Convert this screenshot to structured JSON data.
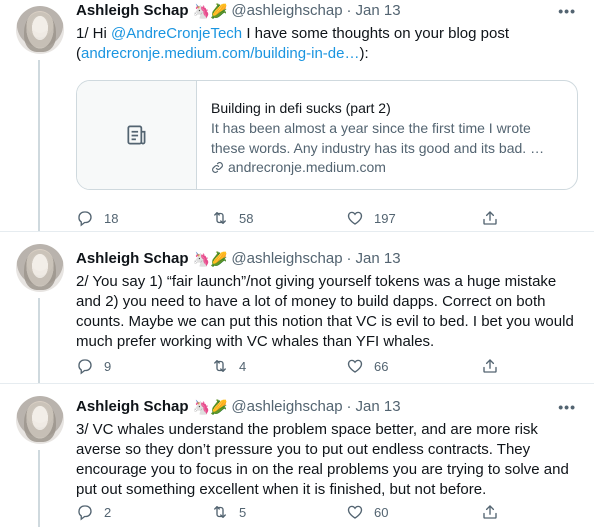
{
  "tweets": [
    {
      "name": "Ashleigh Schap",
      "emoji": "🦄🌽",
      "handle": "@ashleighschap",
      "dot": "·",
      "date": "Jan 13",
      "text_prefix": "1/ Hi ",
      "mention": "@AndreCronjeTech",
      "text_mid": " I have some thoughts on your blog post (",
      "url": "andrecronje.medium.com/building-in-de…",
      "text_suffix": "):",
      "card": {
        "title": "Building in defi sucks (part 2)",
        "description": "It has been almost a year since the first time I wrote these words. Any industry has its good and its bad. …",
        "domain": "andrecronje.medium.com"
      },
      "replies": "18",
      "retweets": "58",
      "likes": "197"
    },
    {
      "name": "Ashleigh Schap",
      "emoji": "🦄🌽",
      "handle": "@ashleighschap",
      "dot": "·",
      "date": "Jan 13",
      "text": "2/ You say 1) “fair launch”/not giving yourself tokens was a huge mistake and 2) you need to have a lot of money to build dapps. Correct on both counts. Maybe we can put this notion that VC is evil to bed. I bet you would much prefer working with VC whales than YFI whales.",
      "replies": "9",
      "retweets": "4",
      "likes": "66"
    },
    {
      "name": "Ashleigh Schap",
      "emoji": "🦄🌽",
      "handle": "@ashleighschap",
      "dot": "·",
      "date": "Jan 13",
      "text": "3/ VC whales understand the problem space better, and are more risk averse so they don’t pressure you to put out endless contracts. They encourage you to focus in on the real problems you are trying to solve and put out something excellent when it is finished, but not before.",
      "replies": "2",
      "retweets": "5",
      "likes": "60"
    }
  ],
  "more_label": "•••",
  "colors": {
    "accent": "#1b95e0",
    "secondary_text": "#536471",
    "border": "#cfd9de"
  },
  "icons": [
    "reply-icon",
    "retweet-icon",
    "like-icon",
    "share-icon",
    "article-icon",
    "link-icon",
    "more-icon"
  ]
}
